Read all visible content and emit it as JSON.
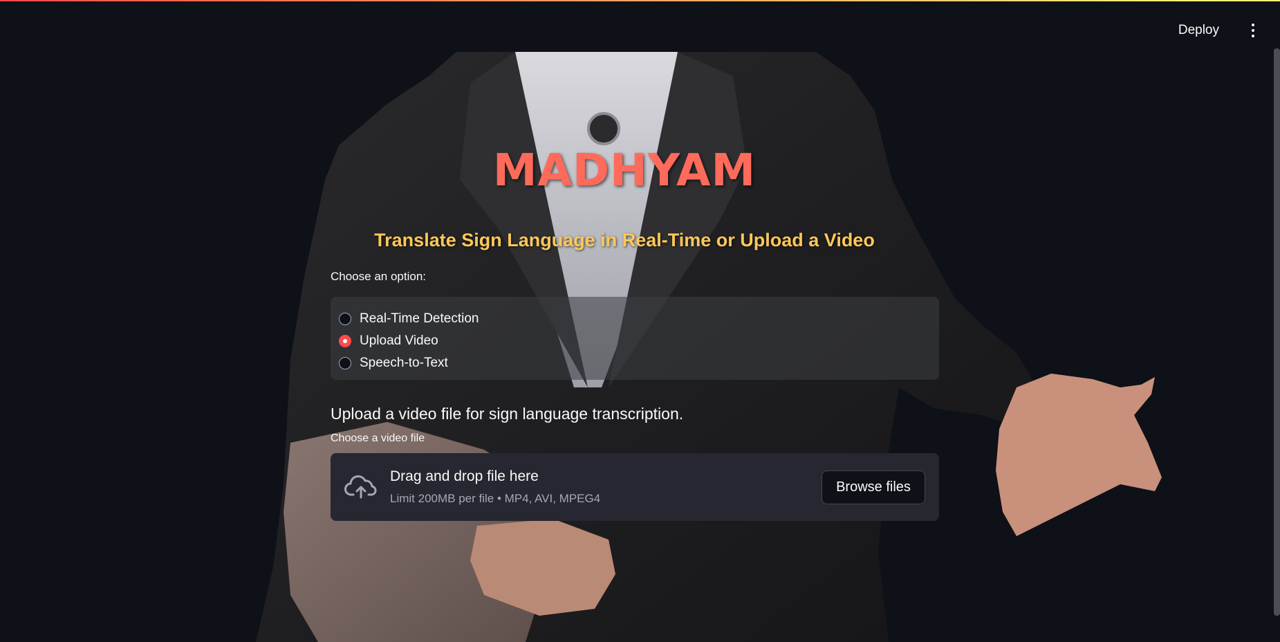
{
  "header": {
    "deploy_label": "Deploy",
    "menu_icon": "kebab-menu-icon"
  },
  "main": {
    "title": "MADHYAM",
    "subtitle": "Translate Sign Language in Real-Time or Upload a Video",
    "radio": {
      "label": "Choose an option:",
      "options": [
        {
          "label": "Real-Time Detection",
          "selected": false
        },
        {
          "label": "Upload Video",
          "selected": true
        },
        {
          "label": "Speech-to-Text",
          "selected": false
        }
      ]
    },
    "upload_caption": "Upload a video file for sign language transcription.",
    "uploader": {
      "label": "Choose a video file",
      "drop_title": "Drag and drop file here",
      "drop_sub": "Limit 200MB per file • MP4, AVI, MPEG4",
      "browse_label": "Browse files",
      "icon": "cloud-upload-icon"
    }
  },
  "colors": {
    "background": "#0e1117",
    "title": "#ff6b5b",
    "subtitle": "#ffc857",
    "accent": "#ff4b4b",
    "dropzone": "#262730"
  }
}
